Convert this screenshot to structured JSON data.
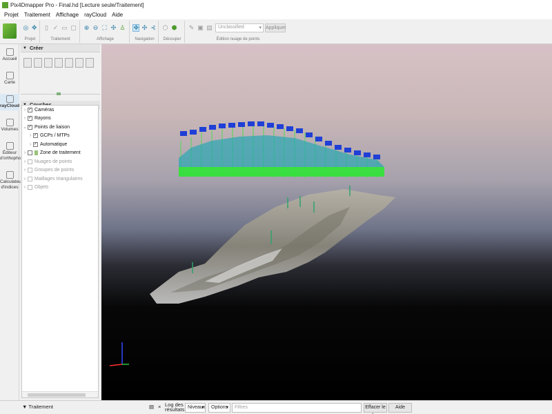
{
  "titlebar": {
    "title": "Pix4Dmapper Pro - Final.hd [Lecture seule/Traitement]"
  },
  "menubar": {
    "items": [
      "Projet",
      "Traitement",
      "Affichage",
      "rayCloud",
      "Aide"
    ]
  },
  "toolbar": {
    "groups": [
      "Projet",
      "Traitement",
      "Affichage",
      "Navigation",
      "Découper",
      "Édition nuage de points"
    ],
    "classification_value": "Unclassified",
    "apply_label": "Appliquer"
  },
  "sidebar": {
    "items": [
      "Accueil",
      "Carte",
      "rayCloud",
      "Volumes",
      "Éditeur d'orthophotos",
      "Calculateur d'indices"
    ]
  },
  "panel": {
    "creer_title": "Créer",
    "couches_title": "Couches",
    "layers": [
      {
        "label": "Caméras",
        "checked": true,
        "indent": 0
      },
      {
        "label": "Rayons",
        "checked": true,
        "indent": 0
      },
      {
        "label": "Points de liaison",
        "checked": true,
        "indent": 0
      },
      {
        "label": "GCPs / MTPs",
        "checked": true,
        "indent": 1
      },
      {
        "label": "Automatique",
        "checked": true,
        "indent": 1
      },
      {
        "label": "Zone de traitement",
        "checked": false,
        "indent": 0
      },
      {
        "label": "Nuages de points",
        "checked": false,
        "indent": 0
      },
      {
        "label": "Groupes de points",
        "checked": false,
        "indent": 0
      },
      {
        "label": "Maillages triangulaires",
        "checked": false,
        "indent": 0
      },
      {
        "label": "Objets",
        "checked": false,
        "indent": 0
      }
    ]
  },
  "statusbar": {
    "traitement_label": "Traitement",
    "log_label": "Log des résultats",
    "niveaux_label": "Niveaux",
    "options_label": "Options",
    "filter_placeholder": "Filtres",
    "clear_label": "Effacer le log",
    "help_label": "Aide"
  },
  "colors": {
    "accent_green": "#5aa02c",
    "camera_blue": "#1f3fd6",
    "point_green": "#35e13b"
  }
}
